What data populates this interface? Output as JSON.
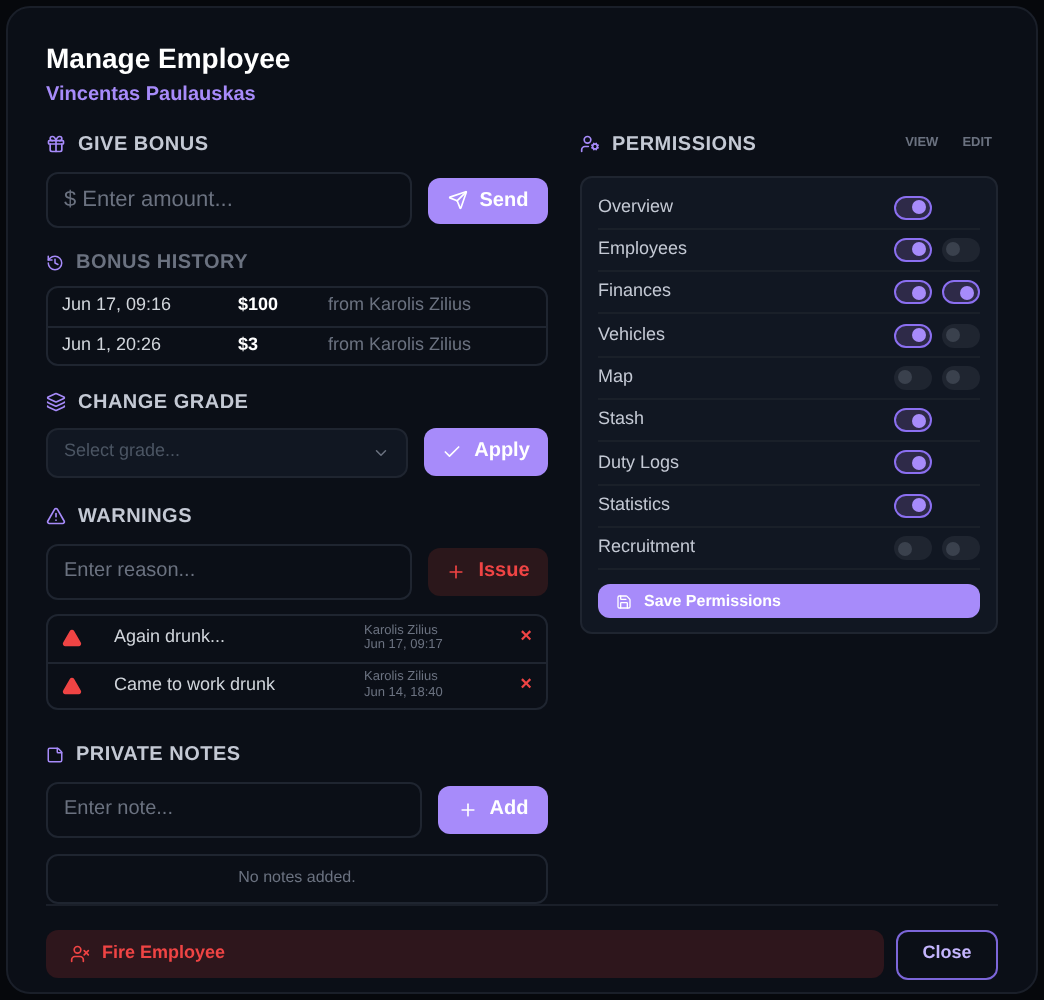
{
  "title": "Manage Employee",
  "subtitle": "Vincentas Paulauskas",
  "bonus": {
    "heading": "GIVE BONUS",
    "placeholder": "$ Enter amount...",
    "button": "Send"
  },
  "history": {
    "heading": "BONUS HISTORY",
    "rows": [
      {
        "date": "Jun 17, 09:16",
        "amount": "$100",
        "from": "from Karolis Zilius"
      },
      {
        "date": "Jun 1, 20:26",
        "amount": "$3",
        "from": "from Karolis Zilius"
      }
    ]
  },
  "grade": {
    "heading": "CHANGE GRADE",
    "placeholder": "Select grade...",
    "button": "Apply"
  },
  "warnings": {
    "heading": "WARNINGS",
    "placeholder": "Enter reason...",
    "button": "Issue",
    "items": [
      {
        "reason": "Again drunk...",
        "author": "Karolis Zilius",
        "date": "Jun 17, 09:17",
        "remove": "×"
      },
      {
        "reason": "Came to work drunk",
        "author": "Karolis Zilius",
        "date": "Jun 14, 18:40",
        "remove": "×"
      }
    ]
  },
  "notes": {
    "heading": "PRIVATE NOTES",
    "placeholder": "Enter note...",
    "button": "Add",
    "empty": "No notes added."
  },
  "permissions": {
    "heading": "PERMISSIONS",
    "view_label": "VIEW",
    "edit_label": "EDIT",
    "button": "Save Permissions",
    "items": [
      {
        "name": "Overview",
        "view": true
      },
      {
        "name": "Employees",
        "view": true,
        "edit": false
      },
      {
        "name": "Finances",
        "view": true,
        "edit": true
      },
      {
        "name": "Vehicles",
        "view": true,
        "edit": false
      },
      {
        "name": "Map",
        "view": false,
        "edit": false
      },
      {
        "name": "Stash",
        "view": true
      },
      {
        "name": "Duty Logs",
        "view": true
      },
      {
        "name": "Statistics",
        "view": true
      },
      {
        "name": "Recruitment",
        "view": false,
        "edit": false
      }
    ]
  },
  "footer": {
    "fire": "Fire Employee",
    "close": "Close"
  }
}
